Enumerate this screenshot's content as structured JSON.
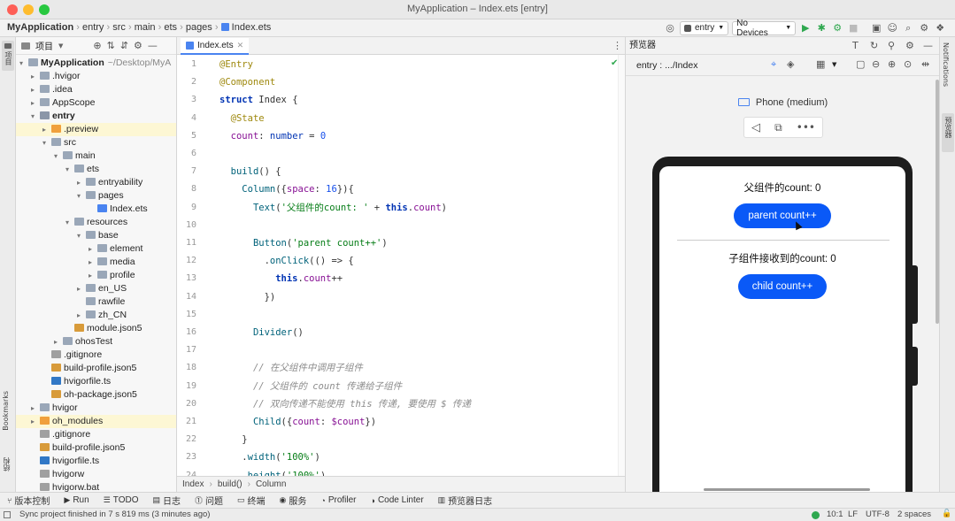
{
  "window": {
    "title": "MyApplication – Index.ets [entry]",
    "traffic_colors": [
      "#fe5f57",
      "#febc2e",
      "#28c840"
    ]
  },
  "breadcrumbs": [
    "MyApplication",
    "entry",
    "src",
    "main",
    "ets",
    "pages",
    "Index.ets"
  ],
  "run_config": {
    "module": "entry",
    "device": "No Devices"
  },
  "left_gutter": {
    "project_label": "项目",
    "bookmarks_label": "Bookmarks",
    "structure_label": "结构"
  },
  "project_panel": {
    "title": "项目",
    "tree": [
      {
        "label": "MyApplication",
        "path": "~/Desktop/MyA",
        "depth": 0,
        "arrow": "open",
        "icon": "folder-icon",
        "highlight": false,
        "bold": true
      },
      {
        "label": ".hvigor",
        "depth": 1,
        "arrow": "closed",
        "icon": "folder-icon",
        "highlight": false
      },
      {
        "label": ".idea",
        "depth": 1,
        "arrow": "closed",
        "icon": "folder-icon",
        "highlight": false
      },
      {
        "label": "AppScope",
        "depth": 1,
        "arrow": "closed",
        "icon": "folder-icon",
        "highlight": false
      },
      {
        "label": "entry",
        "depth": 1,
        "arrow": "open",
        "icon": "module-folder-icon",
        "highlight": false,
        "bold": true
      },
      {
        "label": ".preview",
        "depth": 2,
        "arrow": "closed",
        "icon": "orange-folder-icon",
        "highlight": true
      },
      {
        "label": "src",
        "depth": 2,
        "arrow": "open",
        "icon": "folder-icon",
        "highlight": false
      },
      {
        "label": "main",
        "depth": 3,
        "arrow": "open",
        "icon": "folder-icon",
        "highlight": false
      },
      {
        "label": "ets",
        "depth": 4,
        "arrow": "open",
        "icon": "folder-icon",
        "highlight": false
      },
      {
        "label": "entryability",
        "depth": 5,
        "arrow": "closed",
        "icon": "folder-icon",
        "highlight": false
      },
      {
        "label": "pages",
        "depth": 5,
        "arrow": "open",
        "icon": "folder-icon",
        "highlight": false
      },
      {
        "label": "Index.ets",
        "depth": 6,
        "arrow": "none",
        "icon": "ets-file-icon",
        "highlight": false
      },
      {
        "label": "resources",
        "depth": 4,
        "arrow": "open",
        "icon": "folder-icon",
        "highlight": false
      },
      {
        "label": "base",
        "depth": 5,
        "arrow": "open",
        "icon": "folder-icon",
        "highlight": false
      },
      {
        "label": "element",
        "depth": 6,
        "arrow": "closed",
        "icon": "folder-icon",
        "highlight": false
      },
      {
        "label": "media",
        "depth": 6,
        "arrow": "closed",
        "icon": "folder-icon",
        "highlight": false
      },
      {
        "label": "profile",
        "depth": 6,
        "arrow": "closed",
        "icon": "folder-icon",
        "highlight": false
      },
      {
        "label": "en_US",
        "depth": 5,
        "arrow": "closed",
        "icon": "folder-icon",
        "highlight": false
      },
      {
        "label": "rawfile",
        "depth": 5,
        "arrow": "none",
        "icon": "folder-icon",
        "highlight": false
      },
      {
        "label": "zh_CN",
        "depth": 5,
        "arrow": "closed",
        "icon": "folder-icon",
        "highlight": false
      },
      {
        "label": "module.json5",
        "depth": 4,
        "arrow": "none",
        "icon": "json-file-icon",
        "highlight": false
      },
      {
        "label": "ohosTest",
        "depth": 3,
        "arrow": "closed",
        "icon": "folder-icon",
        "highlight": false
      },
      {
        "label": ".gitignore",
        "depth": 2,
        "arrow": "none",
        "icon": "text-file-icon",
        "highlight": false
      },
      {
        "label": "build-profile.json5",
        "depth": 2,
        "arrow": "none",
        "icon": "json-file-icon",
        "highlight": false
      },
      {
        "label": "hvigorfile.ts",
        "depth": 2,
        "arrow": "none",
        "icon": "ts-file-icon",
        "highlight": false
      },
      {
        "label": "oh-package.json5",
        "depth": 2,
        "arrow": "none",
        "icon": "json-file-icon",
        "highlight": false
      },
      {
        "label": "hvigor",
        "depth": 1,
        "arrow": "closed",
        "icon": "folder-icon",
        "highlight": false
      },
      {
        "label": "oh_modules",
        "depth": 1,
        "arrow": "closed",
        "icon": "orange-folder-icon",
        "highlight": true
      },
      {
        "label": ".gitignore",
        "depth": 1,
        "arrow": "none",
        "icon": "text-file-icon",
        "highlight": false
      },
      {
        "label": "build-profile.json5",
        "depth": 1,
        "arrow": "none",
        "icon": "json-file-icon",
        "highlight": false
      },
      {
        "label": "hvigorfile.ts",
        "depth": 1,
        "arrow": "none",
        "icon": "ts-file-icon",
        "highlight": false
      },
      {
        "label": "hvigorw",
        "depth": 1,
        "arrow": "none",
        "icon": "text-file-icon",
        "highlight": false
      },
      {
        "label": "hvigorw.bat",
        "depth": 1,
        "arrow": "none",
        "icon": "text-file-icon",
        "highlight": false
      }
    ]
  },
  "editor": {
    "tab_label": "Index.ets",
    "current_line": 10,
    "lines": [
      {
        "n": "1",
        "html": "<span class='ann'>@Entry</span>"
      },
      {
        "n": "2",
        "html": "<span class='ann'>@Component</span>"
      },
      {
        "n": "3",
        "html": "<span class='kw'>struct</span> <span class='cls'>Index</span> {"
      },
      {
        "n": "4",
        "html": "  <span class='ann'>@State</span>"
      },
      {
        "n": "5",
        "html": "  <span class='prop'>count</span>: <span class='kwb'>number</span> = <span class='num'>0</span>"
      },
      {
        "n": "6",
        "html": ""
      },
      {
        "n": "7",
        "html": "  <span class='fn'>build</span>() {"
      },
      {
        "n": "8",
        "html": "    <span class='fn'>Column</span>({<span class='prop'>space</span>: <span class='num'>16</span>}){"
      },
      {
        "n": "9",
        "html": "      <span class='fn'>Text</span>(<span class='str'>'父组件的count: '</span> + <span class='kw'>this</span>.<span class='prop'>count</span>)"
      },
      {
        "n": "10",
        "html": ""
      },
      {
        "n": "11",
        "html": "      <span class='fn'>Button</span>(<span class='str'>'parent count++'</span>)"
      },
      {
        "n": "12",
        "html": "        .<span class='fn'>onClick</span>(() => {"
      },
      {
        "n": "13",
        "html": "          <span class='kw'>this</span>.<span class='prop'>count</span>++"
      },
      {
        "n": "14",
        "html": "        })"
      },
      {
        "n": "15",
        "html": ""
      },
      {
        "n": "16",
        "html": "      <span class='fn'>Divider</span>()"
      },
      {
        "n": "17",
        "html": ""
      },
      {
        "n": "18",
        "html": "      <span class='cmt'>// 在父组件中调用子组件</span>"
      },
      {
        "n": "19",
        "html": "      <span class='cmt'>// 父组件的 count 传递给子组件</span>"
      },
      {
        "n": "20",
        "html": "      <span class='cmt'>// 双向传递不能使用 this 传递, 要使用 $ 传递</span>"
      },
      {
        "n": "21",
        "html": "      <span class='fn'>Child</span>({<span class='prop'>count</span>: <span class='dollar'>$count</span>})"
      },
      {
        "n": "22",
        "html": "    }"
      },
      {
        "n": "23",
        "html": "    .<span class='fn'>width</span>(<span class='str'>'100%'</span>)"
      },
      {
        "n": "24",
        "html": "    .<span class='fn'>height</span>(<span class='str'>'100%'</span>)"
      }
    ],
    "status_crumbs": [
      "Index",
      "build()",
      "Column"
    ]
  },
  "previewer": {
    "title": "预览器",
    "route": "entry : .../Index",
    "device_name": "Phone (medium)",
    "app": {
      "parent_text": "父组件的count: 0",
      "parent_button": "parent count++",
      "child_text": "子组件接收到的count: 0",
      "child_button": "child count++"
    },
    "button_color": "#0a59f7"
  },
  "right_gutter": {
    "notifications_label": "Notifications",
    "previewer_label": "预览器"
  },
  "tool_windows": [
    {
      "icon": "vcs-icon",
      "label": "版本控制"
    },
    {
      "icon": "run-icon",
      "label": "Run"
    },
    {
      "icon": "todo-icon",
      "label": "TODO"
    },
    {
      "icon": "log-icon",
      "label": "日志"
    },
    {
      "icon": "problems-icon",
      "label": "问题"
    },
    {
      "icon": "terminal-icon",
      "label": "终端"
    },
    {
      "icon": "services-icon",
      "label": "服务"
    },
    {
      "icon": "profiler-icon",
      "label": "Profiler"
    },
    {
      "icon": "code-linter-icon",
      "label": "Code Linter"
    },
    {
      "icon": "previewer-log-icon",
      "label": "预览器日志"
    }
  ],
  "status": {
    "message": "Sync project finished in 7 s 819 ms (3 minutes ago)",
    "position": "10:1",
    "line_sep": "LF",
    "encoding": "UTF-8",
    "indent": "2 spaces",
    "indicator_color": "#2fa84f"
  }
}
